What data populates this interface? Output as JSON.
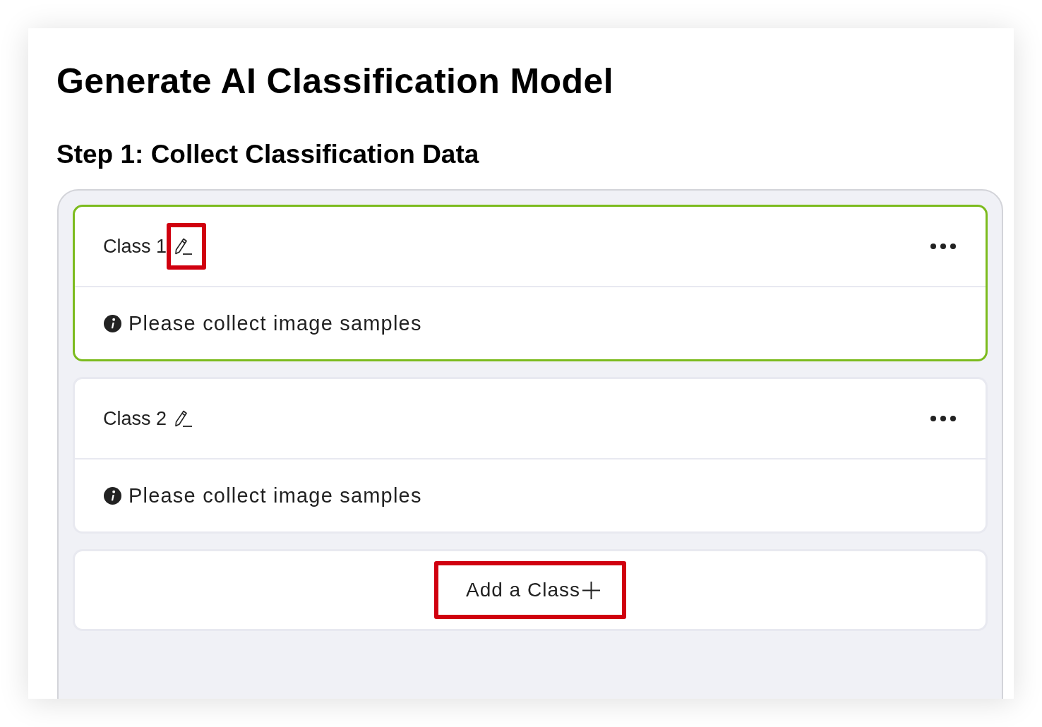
{
  "title": "Generate AI Classification Model",
  "step_heading": "Step 1: Collect Classification Data",
  "classes": [
    {
      "name": "Class 1",
      "selected": true,
      "edit_highlighted": true,
      "message": "Please collect image samples"
    },
    {
      "name": "Class 2",
      "selected": false,
      "edit_highlighted": false,
      "message": "Please collect image samples"
    }
  ],
  "add_class_button": {
    "label": "Add a Class",
    "highlighted": true
  }
}
